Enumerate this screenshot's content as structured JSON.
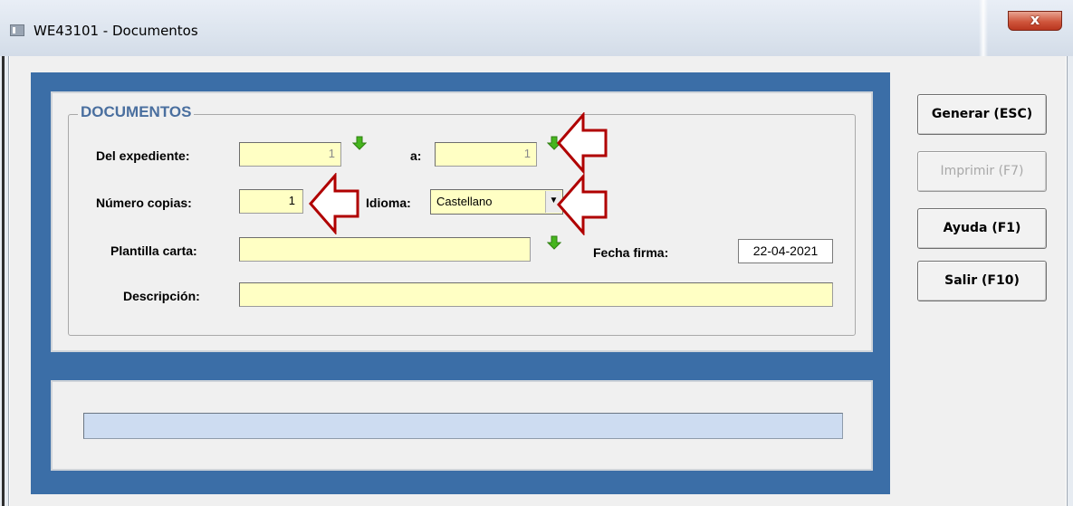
{
  "window": {
    "title": "WE43101 - Documentos",
    "close_label": "x"
  },
  "form": {
    "section_title": "DOCUMENTOS",
    "expediente_label": "Del expediente:",
    "expediente_from": "1",
    "to_label": "a:",
    "expediente_to": "1",
    "copias_label": "Número copias:",
    "copias_value": "1",
    "idioma_label": "Idioma:",
    "idioma_value": "Castellano",
    "plantilla_label": "Plantilla carta:",
    "plantilla_value": "",
    "fecha_label": "Fecha firma:",
    "fecha_value": "22-04-2021",
    "descripcion_label": "Descripción:",
    "descripcion_value": ""
  },
  "buttons": {
    "generar": "Generar (ESC)",
    "imprimir": "Imprimir (F7)",
    "ayuda": "Ayuda (F1)",
    "salir": "Salir (F10)"
  },
  "icons": [
    "window-icon",
    "lookup-arrow-down-icon",
    "dropdown-chevron-icon",
    "callout-arrow-left-icon"
  ],
  "colors": {
    "field_bg": "#ffffc4",
    "panel_blue": "#3b6ea7",
    "legend_blue": "#4a6f9f",
    "lookup_green": "#46b51e",
    "callout_red": "#b00000"
  }
}
